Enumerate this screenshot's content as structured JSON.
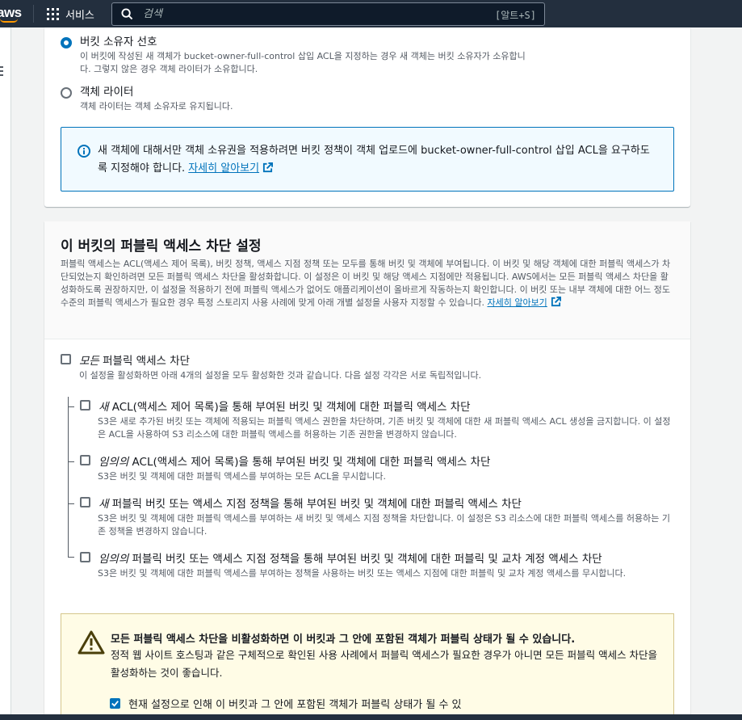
{
  "nav": {
    "logo": "aws",
    "services_label": "서비스",
    "search_placeholder": "검색",
    "search_shortcut": "[알트+S]"
  },
  "ownership": {
    "options": [
      {
        "label": "버킷 소유자 선호",
        "desc": "이 버킷에 작성된 새 객체가 bucket-owner-full-control 삽입 ACL을 지정하는 경우 새 객체는 버킷 소유자가 소유합니다. 그렇지 않은 경우 객체 라이터가 소유합니다.",
        "selected": true
      },
      {
        "label": "객체 라이터",
        "desc": "객체 라이터는 객체 소유자로 유지됩니다.",
        "selected": false
      }
    ],
    "info_text": "새 객체에 대해서만 객체 소유권을 적용하려면 버킷 정책이 객체 업로드에 bucket-owner-full-control 삽입 ACL을 요구하도록 지정해야 합니다.",
    "info_link": "자세히 알아보기"
  },
  "public_access": {
    "title": "이 버킷의 퍼블릭 액세스 차단 설정",
    "desc": "퍼블릭 액세스는 ACL(액세스 제어 목록), 버킷 정책, 액세스 지점 정책 또는 모두를 통해 버킷 및 객체에 부여됩니다. 이 버킷 및 해당 객체에 대한 퍼블릭 액세스가 차단되었는지 확인하려면 모든 퍼블릭 액세스 차단을 활성화합니다. 이 설정은 이 버킷 및 해당 액세스 지점에만 적용됩니다. AWS에서는 모든 퍼블릭 액세스 차단을 활성화하도록 권장하지만, 이 설정을 적용하기 전에 퍼블릭 액세스가 없어도 애플리케이션이 올바르게 작동하는지 확인합니다. 이 버킷 또는 내부 객체에 대한 어느 정도 수준의 퍼블릭 액세스가 필요한 경우 특정 스토리지 사용 사례에 맞게 아래 개별 설정을 사용자 지정할 수 있습니다.",
    "desc_link": "자세히 알아보기",
    "block_all": {
      "label_em": "모든",
      "label_rest": " 퍼블릭 액세스 차단",
      "desc": "이 설정을 활성화하면 아래 4개의 설정을 모두 활성화한 것과 같습니다. 다음 설정 각각은 서로 독립적입니다.",
      "checked": false
    },
    "items": [
      {
        "label_em": "새",
        "label_rest": " ACL(액세스 제어 목록)을 통해 부여된 버킷 및 객체에 대한 퍼블릭 액세스 차단",
        "desc": "S3은 새로 추가된 버킷 또는 객체에 적용되는 퍼블릭 액세스 권한을 차단하며, 기존 버킷 및 객체에 대한 새 퍼블릭 액세스 ACL 생성을 금지합니다. 이 설정은 ACL을 사용하여 S3 리소스에 대한 퍼블릭 액세스를 허용하는 기존 권한을 변경하지 않습니다.",
        "checked": false
      },
      {
        "label_em": "임의의",
        "label_rest": " ACL(액세스 제어 목록)을 통해 부여된 버킷 및 객체에 대한 퍼블릭 액세스 차단",
        "desc": "S3은 버킷 및 객체에 대한 퍼블릭 액세스를 부여하는 모든 ACL을 무시합니다.",
        "checked": false
      },
      {
        "label_em": "새",
        "label_rest": " 퍼블릭 버킷 또는 액세스 지점 정책을 통해 부여된 버킷 및 객체에 대한 퍼블릭 액세스 차단",
        "desc": "S3은 버킷 및 객체에 대한 퍼블릭 액세스를 부여하는 새 버킷 및 액세스 지점 정책을 차단합니다. 이 설정은 S3 리소스에 대한 퍼블릭 액세스를 허용하는 기존 정책을 변경하지 않습니다.",
        "checked": false
      },
      {
        "label_em": "임의의",
        "label_rest": " 퍼블릭 버킷 또는 액세스 지점 정책을 통해 부여된 버킷 및 객체에 대한 퍼블릭 및 교차 계정 액세스 차단",
        "desc": "S3은 버킷 및 객체에 대한 퍼블릭 액세스를 부여하는 정책을 사용하는 버킷 또는 액세스 지점에 대한 퍼블릭 및 교차 계정 액세스를 무시합니다.",
        "checked": false
      }
    ],
    "warning": {
      "title": "모든 퍼블릭 액세스 차단을 비활성화하면 이 버킷과 그 안에 포함된 객체가 퍼블릭 상태가 될 수 있습니다.",
      "body": "정적 웹 사이트 호스팅과 같은 구체적으로 확인된 사용 사례에서 퍼블릭 액세스가 필요한 경우가 아니면 모든 퍼블릭 액세스 차단을 활성화하는 것이 좋습니다.",
      "ack_label": "현재 설정으로 인해 이 버킷과 그 안에 포함된 객체가 퍼블릭 상태가 될 수 있",
      "ack_checked": true
    }
  },
  "colors": {
    "nav_bg": "#232f3e",
    "accent": "#0073bb",
    "warning_bg": "#fffce6"
  }
}
